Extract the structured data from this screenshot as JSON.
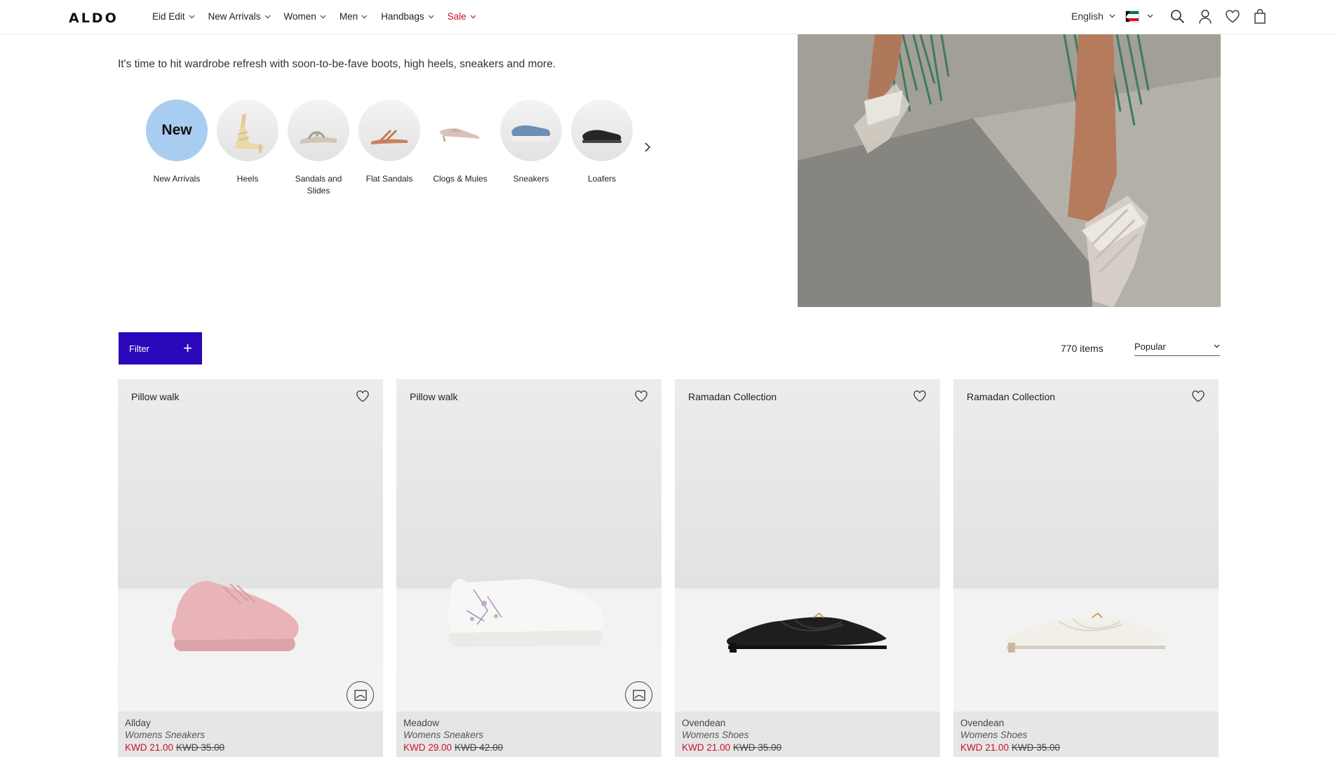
{
  "header": {
    "logo": "ALDO",
    "nav": [
      {
        "label": "Eid Edit"
      },
      {
        "label": "New Arrivals"
      },
      {
        "label": "Women"
      },
      {
        "label": "Men"
      },
      {
        "label": "Handbags"
      },
      {
        "label": "Sale"
      }
    ],
    "language": "English",
    "icons": [
      "search-icon",
      "account-icon",
      "wishlist-icon",
      "bag-icon"
    ]
  },
  "intro": {
    "text": "It's time to hit wardrobe refresh with soon-to-be-fave boots, high heels, sneakers and more."
  },
  "categories": [
    {
      "label": "New Arrivals",
      "badge": "New"
    },
    {
      "label": "Heels"
    },
    {
      "label": "Sandals and Slides"
    },
    {
      "label": "Flat Sandals"
    },
    {
      "label": "Clogs & Mules"
    },
    {
      "label": "Sneakers"
    },
    {
      "label": "Loafers"
    }
  ],
  "toolbar": {
    "filter_label": "Filter",
    "items_count": "770 items",
    "sort_value": "Popular"
  },
  "products": [
    {
      "badge": "Pillow walk",
      "name": "Allday",
      "type": "Womens Sneakers",
      "sale_price": "KWD 21.00",
      "orig_price": "KWD 35.00",
      "color": "#e9b4b8"
    },
    {
      "badge": "Pillow walk",
      "name": "Meadow",
      "type": "Womens Sneakers",
      "sale_price": "KWD 29.00",
      "orig_price": "KWD 42.00",
      "color": "#f7f7f5"
    },
    {
      "badge": "Ramadan Collection",
      "name": "Ovendean",
      "type": "Womens Shoes",
      "sale_price": "KWD 21.00",
      "orig_price": "KWD 35.00",
      "color": "#1e1e1e"
    },
    {
      "badge": "Ramadan Collection",
      "name": "Ovendean",
      "type": "Womens Shoes",
      "sale_price": "KWD 21.00",
      "orig_price": "KWD 35.00",
      "color": "#f1efe8"
    }
  ],
  "colors": {
    "brand_accent": "#2a07b8",
    "sale_red": "#c8102e",
    "new_badge_bg": "#a9cdf0"
  }
}
